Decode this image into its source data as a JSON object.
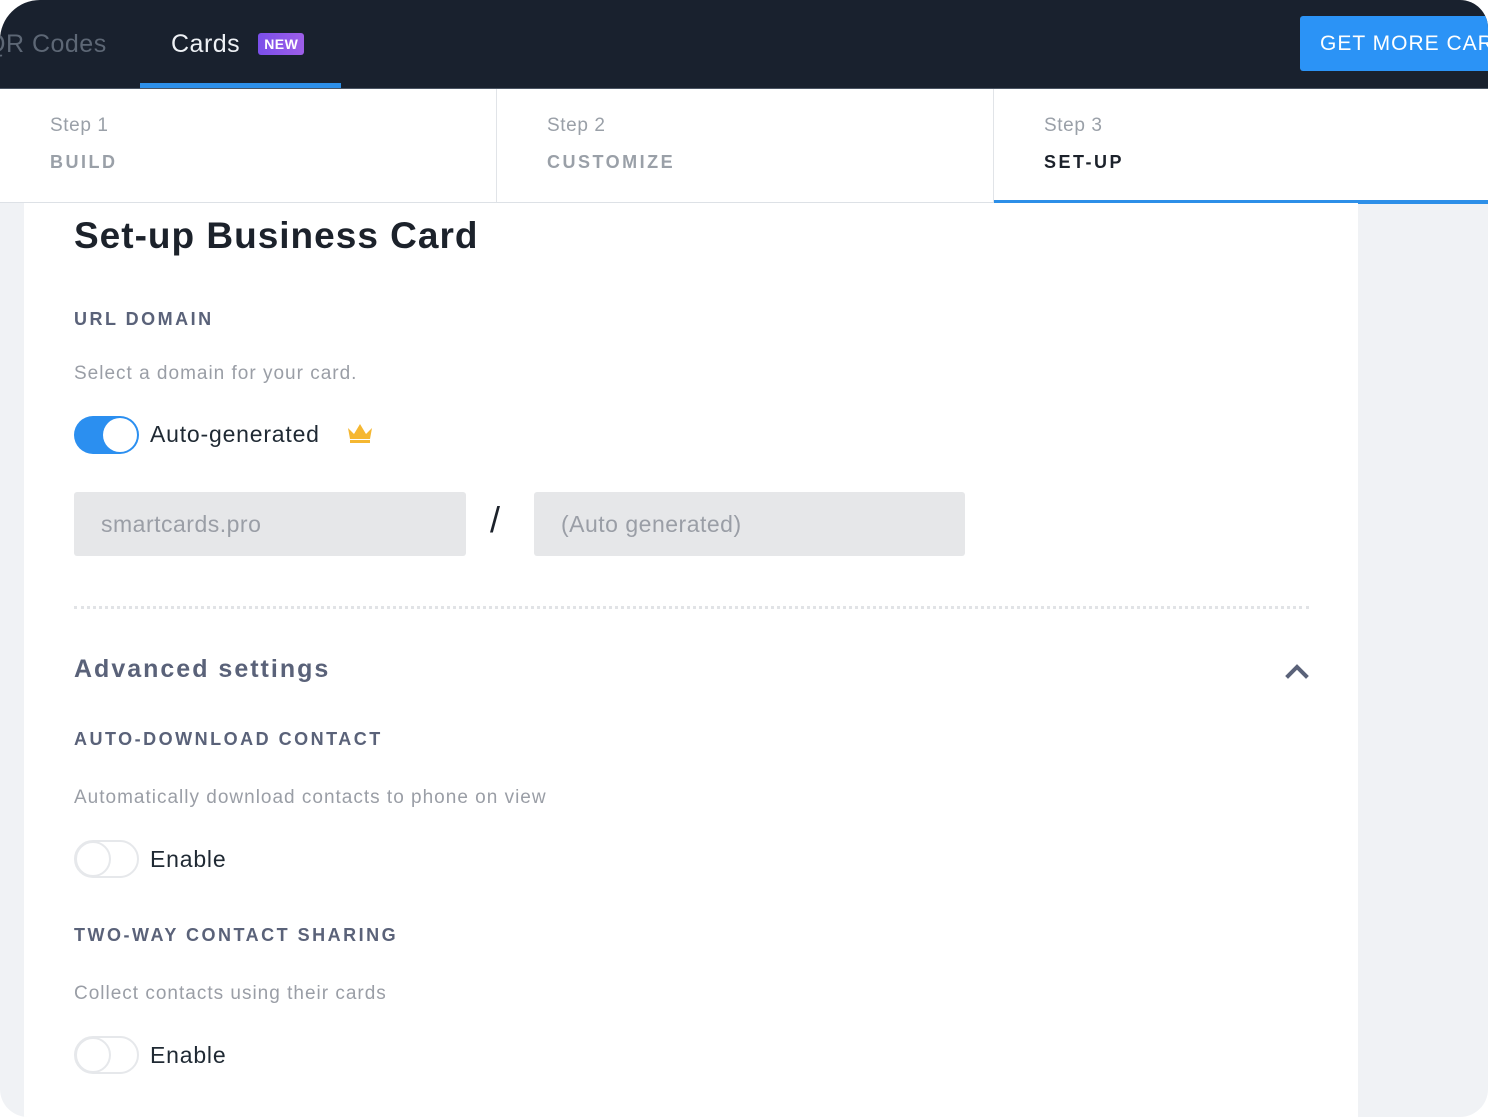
{
  "topnav": {
    "tabs": [
      {
        "label": "QR Codes",
        "active": false
      },
      {
        "label": "Cards",
        "active": true,
        "badge": "NEW"
      }
    ],
    "cta_label": "GET MORE CARDS"
  },
  "steps": [
    {
      "number": "Step 1",
      "label": "BUILD",
      "active": false
    },
    {
      "number": "Step 2",
      "label": "CUSTOMIZE",
      "active": false
    },
    {
      "number": "Step 3",
      "label": "SET-UP",
      "active": true
    }
  ],
  "main": {
    "title": "Set-up Business Card",
    "url_domain": {
      "heading": "URL DOMAIN",
      "description": "Select a domain for your card.",
      "toggle_label": "Auto-generated",
      "toggle_on": true,
      "premium_icon": "crown-icon",
      "domain_value": "smartcards.pro",
      "separator": "/",
      "slug_placeholder": "(Auto generated)"
    },
    "advanced": {
      "title": "Advanced settings",
      "expanded": true,
      "sections": [
        {
          "heading": "AUTO-DOWNLOAD CONTACT",
          "description": "Automatically download contacts to phone on view",
          "toggle_label": "Enable",
          "toggle_on": false
        },
        {
          "heading": "TWO-WAY CONTACT SHARING",
          "description": "Collect contacts using their cards",
          "toggle_label": "Enable",
          "toggle_on": false
        }
      ]
    }
  },
  "colors": {
    "nav_bg": "#19212e",
    "accent": "#2b8ff0",
    "badge": "#8b55ea",
    "crown": "#f5b731",
    "heading": "#5a6279"
  }
}
